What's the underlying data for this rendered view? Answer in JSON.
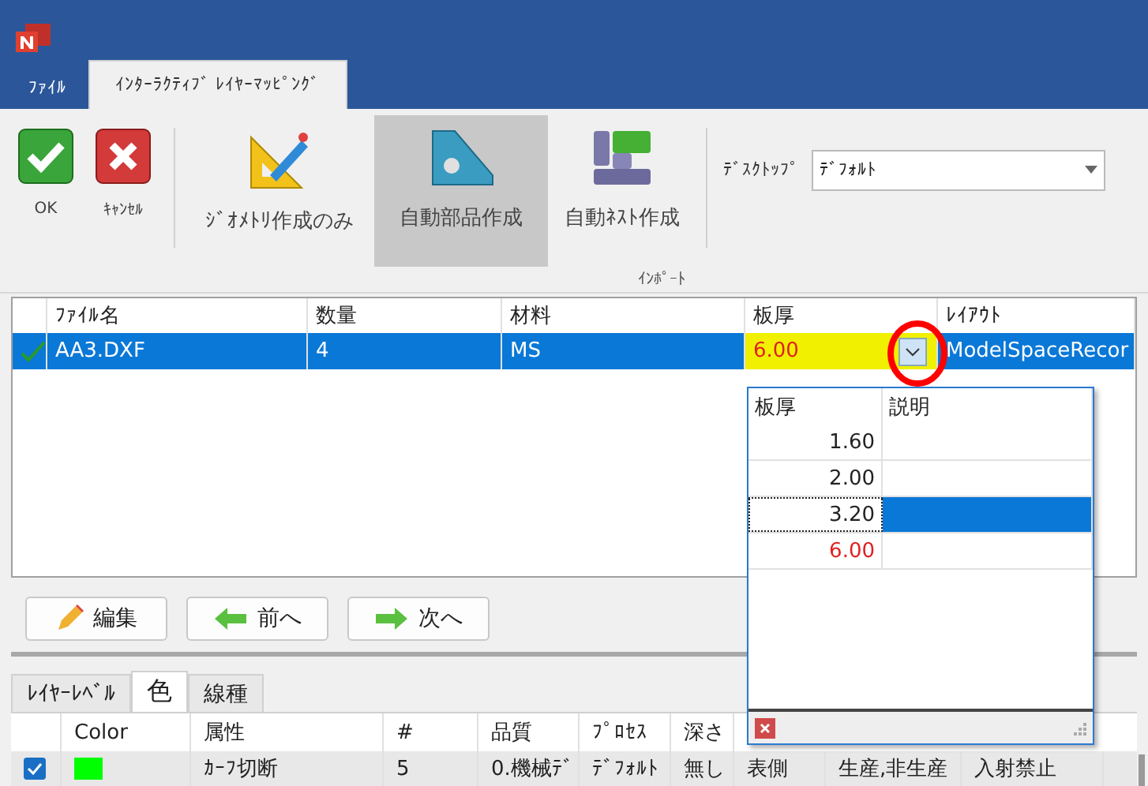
{
  "ribbon_tabs": [
    {
      "label": "ﾌｧｲﾙ",
      "selected": false
    },
    {
      "label": "ｲﾝﾀｰﾗｸﾃｨﾌﾞ ﾚｲﾔｰﾏｯﾋﾟﾝｸﾞ",
      "selected": true
    }
  ],
  "ribbon": {
    "buttons": [
      {
        "kind": "ok",
        "label": "OK",
        "selected": false
      },
      {
        "kind": "cancel",
        "label": "ｷｬﾝｾﾙ",
        "selected": false
      },
      {
        "kind": "geometry",
        "label": "ｼﾞｵﾒﾄﾘ作成のみ",
        "selected": false
      },
      {
        "kind": "parts",
        "label": "自動部品作成",
        "selected": true
      },
      {
        "kind": "nest",
        "label": "自動ﾈｽﾄ作成",
        "selected": false
      }
    ],
    "desktop": {
      "label": "ﾃﾞｽｸﾄｯﾌﾟ",
      "value": "ﾃﾞﾌｫﾙﾄ"
    },
    "group_label": "ｲﾝﾎﾟｰﾄ"
  },
  "file_grid": {
    "columns": [
      "ﾌｧｲﾙ名",
      "数量",
      "材料",
      "板厚",
      "ﾚｲｱｳﾄ"
    ],
    "rows": [
      {
        "checked": true,
        "selected": true,
        "file": "AA3.DXF",
        "quantity": "4",
        "material": "MS",
        "thickness": "6.00",
        "layout": "ModelSpaceRecor"
      }
    ]
  },
  "thickness_dropdown": {
    "columns": [
      "板厚",
      "説明"
    ],
    "rows": [
      {
        "thickness": "1.60",
        "selected": false,
        "current": false
      },
      {
        "thickness": "2.00",
        "selected": false,
        "current": false
      },
      {
        "thickness": "3.20",
        "selected": true,
        "current": false
      },
      {
        "thickness": "6.00",
        "selected": false,
        "current": true
      }
    ]
  },
  "nav_buttons": [
    {
      "kind": "edit",
      "label": "編集"
    },
    {
      "kind": "prev",
      "label": "前へ"
    },
    {
      "kind": "next",
      "label": "次へ"
    }
  ],
  "layer_tabs": [
    {
      "label": "ﾚｲﾔｰﾚﾍﾞﾙ",
      "selected": false
    },
    {
      "label": "色",
      "selected": true
    },
    {
      "label": "線種",
      "selected": false
    }
  ],
  "layer_grid": {
    "columns": [
      "Color",
      "属性",
      "#",
      "品質",
      "ﾌﾟﾛｾｽ",
      "深さ"
    ],
    "rows": [
      {
        "checked": true,
        "color": "#00ff00",
        "cells": [
          "",
          "ｶｰﾌ切断",
          "5",
          "0.機械ﾃﾞ",
          "ﾃﾞﾌｫﾙﾄ",
          "無し",
          "表側",
          "生産,非生産",
          "入射禁止"
        ]
      }
    ]
  }
}
